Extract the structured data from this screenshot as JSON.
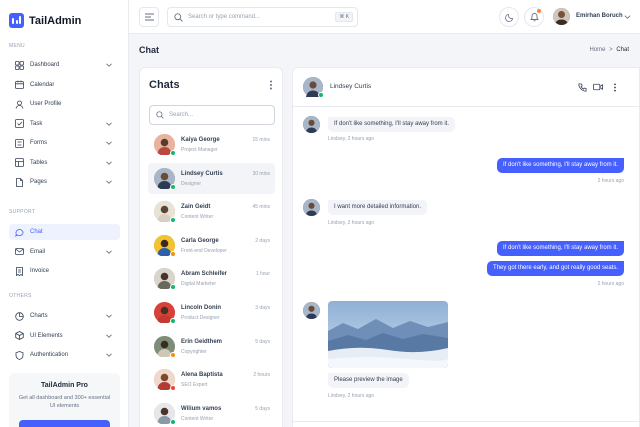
{
  "brand": {
    "name": "TailAdmin",
    "accent": "#465fff"
  },
  "sidebar": {
    "menu_label": "MENU",
    "support_label": "SUPPORT",
    "others_label": "OTHERS",
    "menu": [
      {
        "label": "Dashboard",
        "icon": "grid-icon",
        "chevron": true
      },
      {
        "label": "Calendar",
        "icon": "calendar-icon",
        "chevron": false
      },
      {
        "label": "User Profile",
        "icon": "user-icon",
        "chevron": false
      },
      {
        "label": "Task",
        "icon": "task-icon",
        "chevron": true
      },
      {
        "label": "Forms",
        "icon": "form-icon",
        "chevron": true
      },
      {
        "label": "Tables",
        "icon": "table-icon",
        "chevron": true
      },
      {
        "label": "Pages",
        "icon": "page-icon",
        "chevron": true
      }
    ],
    "support": [
      {
        "label": "Chat",
        "icon": "chat-icon",
        "chevron": false,
        "active": true
      },
      {
        "label": "Email",
        "icon": "mail-icon",
        "chevron": true
      },
      {
        "label": "Invoice",
        "icon": "invoice-icon",
        "chevron": false
      }
    ],
    "others": [
      {
        "label": "Charts",
        "icon": "pie-chart-icon",
        "chevron": true
      },
      {
        "label": "UI Elements",
        "icon": "box-icon",
        "chevron": true
      },
      {
        "label": "Authentication",
        "icon": "shield-icon",
        "chevron": true
      }
    ],
    "promo": {
      "title": "TailAdmin Pro",
      "desc": "Get all dashboard and 300+ essential UI elements"
    }
  },
  "header": {
    "search_placeholder": "Search or type command...",
    "search_shortcut": "⌘ K",
    "user_name": "Emirhan Boruch"
  },
  "page": {
    "title": "Chat",
    "breadcrumb_home": "Home",
    "breadcrumb_sep": ">",
    "breadcrumb_current": "Chat"
  },
  "chats": {
    "title": "Chats",
    "search_placeholder": "Search...",
    "contacts": [
      {
        "name": "Kaiya George",
        "role": "Project Manager",
        "time": "15 mins",
        "status": "#12b76a",
        "selected": false
      },
      {
        "name": "Lindsey Curtis",
        "role": "Designer",
        "time": "30 mins",
        "status": "#12b76a",
        "selected": true
      },
      {
        "name": "Zain Geidt",
        "role": "Content Writer",
        "time": "45 mins",
        "status": "#12b76a",
        "selected": false
      },
      {
        "name": "Carla George",
        "role": "Front-end Developer",
        "time": "2 days",
        "status": "#f79009",
        "selected": false
      },
      {
        "name": "Abram Schleifer",
        "role": "Digital Marketer",
        "time": "1 hour",
        "status": "#12b76a",
        "selected": false
      },
      {
        "name": "Lincoln Donin",
        "role": "Product Designer",
        "time": "3 days",
        "status": "#12b76a",
        "selected": false
      },
      {
        "name": "Erin Geidthem",
        "role": "Copyrighter",
        "time": "5 days",
        "status": "#f79009",
        "selected": false
      },
      {
        "name": "Alena Baptista",
        "role": "SEO Expert",
        "time": "2 hours",
        "status": "#f04438",
        "selected": false
      },
      {
        "name": "Wilium vamos",
        "role": "Content Writer",
        "time": "5 days",
        "status": "#12b76a",
        "selected": false
      }
    ]
  },
  "conversation": {
    "contact_name": "Lindsey Curtis",
    "messages": {
      "m1": {
        "text": "If don't like something, I'll stay away from it.",
        "meta": "Lindsey, 2 hours ago"
      },
      "m2": {
        "text": "If don't like something, I'll stay away from it.",
        "meta": "2 hours ago"
      },
      "m3": {
        "text": "I want more detailed information.",
        "meta": "Lindsey, 2 hours ago"
      },
      "m4a": {
        "text": "If don't like something, I'll stay away from it."
      },
      "m4b": {
        "text": "They got there early, and got really good seats.",
        "meta": "2 hours ago"
      },
      "m5": {
        "text": "Please preview the image",
        "meta": "Lindsey, 2 hours ago"
      }
    }
  }
}
